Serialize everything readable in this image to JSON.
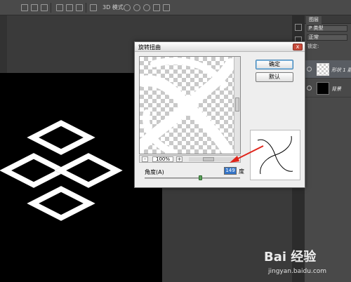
{
  "options_bar": {
    "mode_label": "3D 模式:"
  },
  "layers_panel": {
    "tab_label": "图层",
    "filter_kind": "P 类型",
    "blend_mode": "正常",
    "lock_label": "锁定:",
    "layers": [
      {
        "name": "形状 1 副",
        "active": true
      },
      {
        "name": "背景",
        "active": false
      }
    ]
  },
  "dialog": {
    "title": "旋转扭曲",
    "close_label": "x",
    "ok_button": "确定",
    "default_button": "默认",
    "zoom_minus": "-",
    "zoom_plus": "+",
    "zoom_level": "100%",
    "angle_label": "角度(A)",
    "angle_value": "149",
    "angle_unit": "度",
    "angle_slider_fraction": 0.6
  },
  "watermark": {
    "logo": "Bai 经验",
    "url": "jingyan.baidu.com"
  }
}
